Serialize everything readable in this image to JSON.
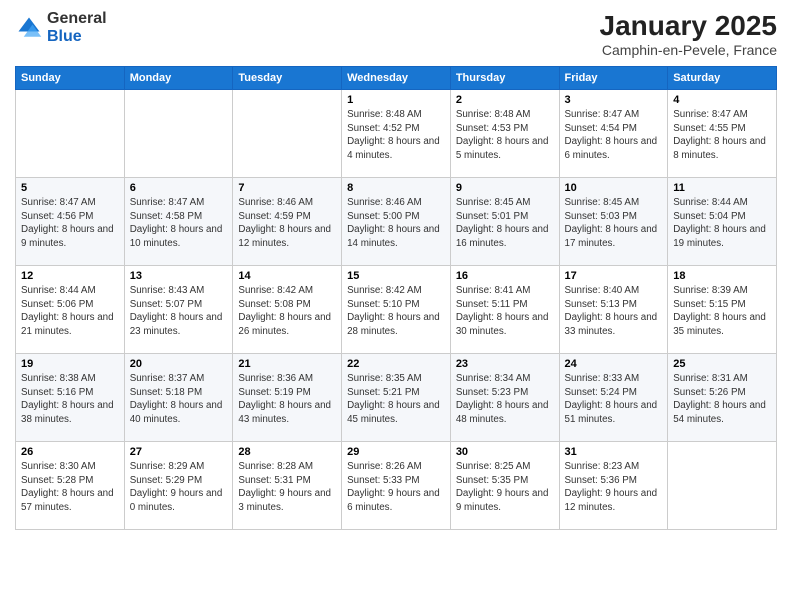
{
  "header": {
    "logo_general": "General",
    "logo_blue": "Blue",
    "title": "January 2025",
    "subtitle": "Camphin-en-Pevele, France"
  },
  "weekdays": [
    "Sunday",
    "Monday",
    "Tuesday",
    "Wednesday",
    "Thursday",
    "Friday",
    "Saturday"
  ],
  "weeks": [
    [
      {
        "num": "",
        "detail": ""
      },
      {
        "num": "",
        "detail": ""
      },
      {
        "num": "",
        "detail": ""
      },
      {
        "num": "1",
        "detail": "Sunrise: 8:48 AM\nSunset: 4:52 PM\nDaylight: 8 hours\nand 4 minutes."
      },
      {
        "num": "2",
        "detail": "Sunrise: 8:48 AM\nSunset: 4:53 PM\nDaylight: 8 hours\nand 5 minutes."
      },
      {
        "num": "3",
        "detail": "Sunrise: 8:47 AM\nSunset: 4:54 PM\nDaylight: 8 hours\nand 6 minutes."
      },
      {
        "num": "4",
        "detail": "Sunrise: 8:47 AM\nSunset: 4:55 PM\nDaylight: 8 hours\nand 8 minutes."
      }
    ],
    [
      {
        "num": "5",
        "detail": "Sunrise: 8:47 AM\nSunset: 4:56 PM\nDaylight: 8 hours\nand 9 minutes."
      },
      {
        "num": "6",
        "detail": "Sunrise: 8:47 AM\nSunset: 4:58 PM\nDaylight: 8 hours\nand 10 minutes."
      },
      {
        "num": "7",
        "detail": "Sunrise: 8:46 AM\nSunset: 4:59 PM\nDaylight: 8 hours\nand 12 minutes."
      },
      {
        "num": "8",
        "detail": "Sunrise: 8:46 AM\nSunset: 5:00 PM\nDaylight: 8 hours\nand 14 minutes."
      },
      {
        "num": "9",
        "detail": "Sunrise: 8:45 AM\nSunset: 5:01 PM\nDaylight: 8 hours\nand 16 minutes."
      },
      {
        "num": "10",
        "detail": "Sunrise: 8:45 AM\nSunset: 5:03 PM\nDaylight: 8 hours\nand 17 minutes."
      },
      {
        "num": "11",
        "detail": "Sunrise: 8:44 AM\nSunset: 5:04 PM\nDaylight: 8 hours\nand 19 minutes."
      }
    ],
    [
      {
        "num": "12",
        "detail": "Sunrise: 8:44 AM\nSunset: 5:06 PM\nDaylight: 8 hours\nand 21 minutes."
      },
      {
        "num": "13",
        "detail": "Sunrise: 8:43 AM\nSunset: 5:07 PM\nDaylight: 8 hours\nand 23 minutes."
      },
      {
        "num": "14",
        "detail": "Sunrise: 8:42 AM\nSunset: 5:08 PM\nDaylight: 8 hours\nand 26 minutes."
      },
      {
        "num": "15",
        "detail": "Sunrise: 8:42 AM\nSunset: 5:10 PM\nDaylight: 8 hours\nand 28 minutes."
      },
      {
        "num": "16",
        "detail": "Sunrise: 8:41 AM\nSunset: 5:11 PM\nDaylight: 8 hours\nand 30 minutes."
      },
      {
        "num": "17",
        "detail": "Sunrise: 8:40 AM\nSunset: 5:13 PM\nDaylight: 8 hours\nand 33 minutes."
      },
      {
        "num": "18",
        "detail": "Sunrise: 8:39 AM\nSunset: 5:15 PM\nDaylight: 8 hours\nand 35 minutes."
      }
    ],
    [
      {
        "num": "19",
        "detail": "Sunrise: 8:38 AM\nSunset: 5:16 PM\nDaylight: 8 hours\nand 38 minutes."
      },
      {
        "num": "20",
        "detail": "Sunrise: 8:37 AM\nSunset: 5:18 PM\nDaylight: 8 hours\nand 40 minutes."
      },
      {
        "num": "21",
        "detail": "Sunrise: 8:36 AM\nSunset: 5:19 PM\nDaylight: 8 hours\nand 43 minutes."
      },
      {
        "num": "22",
        "detail": "Sunrise: 8:35 AM\nSunset: 5:21 PM\nDaylight: 8 hours\nand 45 minutes."
      },
      {
        "num": "23",
        "detail": "Sunrise: 8:34 AM\nSunset: 5:23 PM\nDaylight: 8 hours\nand 48 minutes."
      },
      {
        "num": "24",
        "detail": "Sunrise: 8:33 AM\nSunset: 5:24 PM\nDaylight: 8 hours\nand 51 minutes."
      },
      {
        "num": "25",
        "detail": "Sunrise: 8:31 AM\nSunset: 5:26 PM\nDaylight: 8 hours\nand 54 minutes."
      }
    ],
    [
      {
        "num": "26",
        "detail": "Sunrise: 8:30 AM\nSunset: 5:28 PM\nDaylight: 8 hours\nand 57 minutes."
      },
      {
        "num": "27",
        "detail": "Sunrise: 8:29 AM\nSunset: 5:29 PM\nDaylight: 9 hours\nand 0 minutes."
      },
      {
        "num": "28",
        "detail": "Sunrise: 8:28 AM\nSunset: 5:31 PM\nDaylight: 9 hours\nand 3 minutes."
      },
      {
        "num": "29",
        "detail": "Sunrise: 8:26 AM\nSunset: 5:33 PM\nDaylight: 9 hours\nand 6 minutes."
      },
      {
        "num": "30",
        "detail": "Sunrise: 8:25 AM\nSunset: 5:35 PM\nDaylight: 9 hours\nand 9 minutes."
      },
      {
        "num": "31",
        "detail": "Sunrise: 8:23 AM\nSunset: 5:36 PM\nDaylight: 9 hours\nand 12 minutes."
      },
      {
        "num": "",
        "detail": ""
      }
    ]
  ]
}
